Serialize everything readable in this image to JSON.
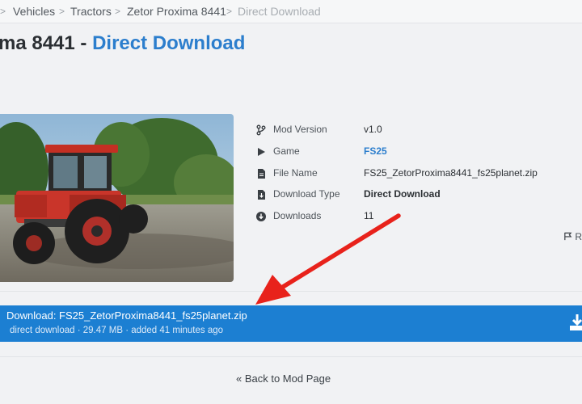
{
  "breadcrumb": {
    "items": [
      "Vehicles",
      "Tractors",
      "Zetor Proxima 8441",
      "Direct Download"
    ]
  },
  "title": {
    "prefix": "ma 8441 - ",
    "accent": "Direct Download"
  },
  "info": {
    "mod_version": {
      "label": "Mod Version",
      "value": "v1.0"
    },
    "game": {
      "label": "Game",
      "value": "FS25"
    },
    "file_name": {
      "label": "File Name",
      "value": "FS25_ZetorProxima8441_fs25planet.zip"
    },
    "download_type": {
      "label": "Download Type",
      "value": "Direct Download"
    },
    "downloads": {
      "label": "Downloads",
      "value": "11"
    }
  },
  "report": {
    "label": "Re"
  },
  "download": {
    "title": "Download: FS25_ZetorProxima8441_fs25planet.zip",
    "subtitle": "direct download · 29.47 MB · added 41 minutes ago"
  },
  "back": {
    "label": "« Back to Mod Page"
  },
  "colors": {
    "accent": "#2c7ecd",
    "download_bar": "#1c7fd2",
    "annotation_arrow": "#e8221b"
  }
}
